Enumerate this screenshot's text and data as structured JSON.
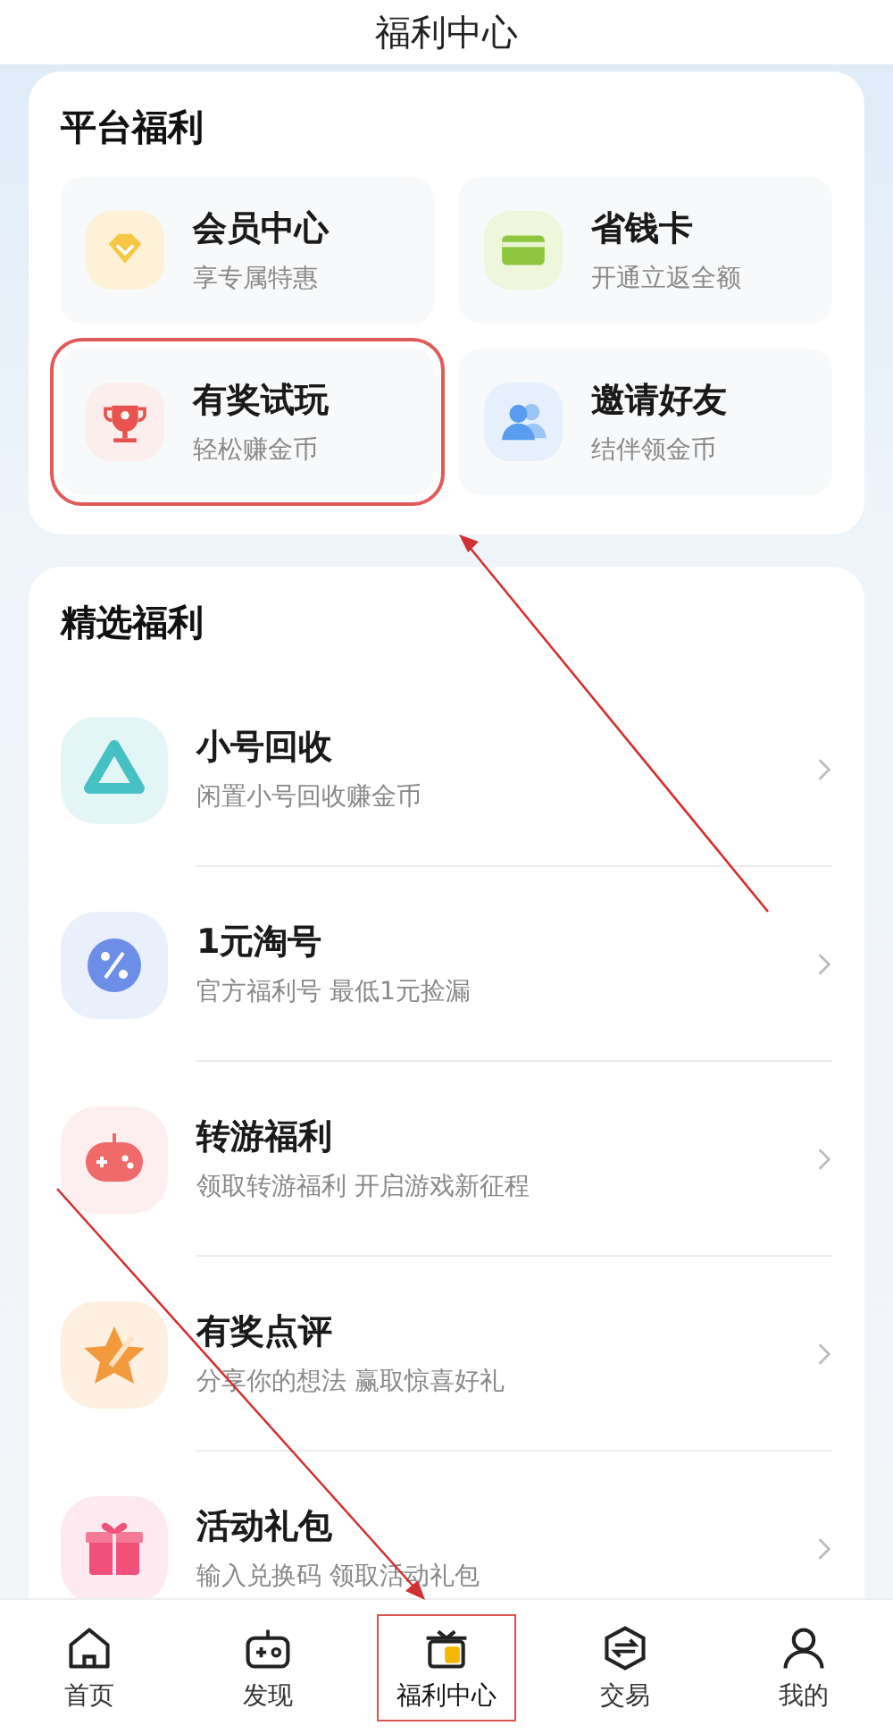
{
  "header": {
    "title": "福利中心"
  },
  "platform": {
    "title": "平台福利",
    "items": [
      {
        "title": "会员中心",
        "subtitle": "享专属特惠",
        "kind": "diamond",
        "highlighted": false
      },
      {
        "title": "省钱卡",
        "subtitle": "开通立返全额",
        "kind": "card",
        "highlighted": false
      },
      {
        "title": "有奖试玩",
        "subtitle": "轻松赚金币",
        "kind": "trophy",
        "highlighted": true
      },
      {
        "title": "邀请好友",
        "subtitle": "结伴领金币",
        "kind": "people",
        "highlighted": false
      }
    ]
  },
  "featured": {
    "title": "精选福利",
    "items": [
      {
        "title": "小号回收",
        "subtitle": "闲置小号回收赚金币",
        "kind": "triangle"
      },
      {
        "title": "1元淘号",
        "subtitle": "官方福利号 最低1元捡漏",
        "kind": "percent"
      },
      {
        "title": "转游福利",
        "subtitle": "领取转游福利 开启游戏新征程",
        "kind": "gamepad"
      },
      {
        "title": "有奖点评",
        "subtitle": "分享你的想法 赢取惊喜好礼",
        "kind": "star"
      },
      {
        "title": "活动礼包",
        "subtitle": "输入兑换码 领取活动礼包",
        "kind": "gift"
      }
    ]
  },
  "tabs": [
    {
      "label": "首页",
      "kind": "home",
      "selected": false,
      "highlighted": false
    },
    {
      "label": "发现",
      "kind": "controller",
      "selected": false,
      "highlighted": false
    },
    {
      "label": "福利中心",
      "kind": "gift",
      "selected": true,
      "highlighted": true
    },
    {
      "label": "交易",
      "kind": "exchange",
      "selected": false,
      "highlighted": false
    },
    {
      "label": "我的",
      "kind": "user",
      "selected": false,
      "highlighted": false
    }
  ]
}
